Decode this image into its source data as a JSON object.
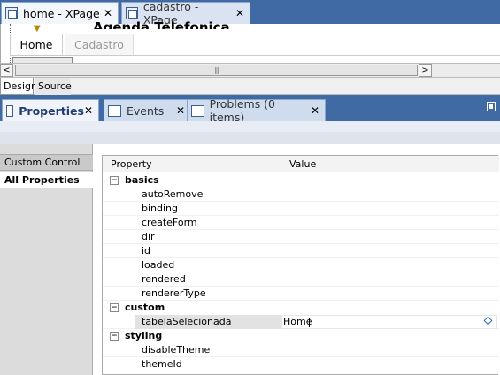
{
  "editor_tabs": [
    {
      "label": "home - XPage",
      "close": "✕"
    },
    {
      "label": "cadastro - XPage",
      "close": "✕"
    }
  ],
  "canvas": {
    "page_title": "Agenda Telefonica",
    "tabs": [
      "Home",
      "Cadastro"
    ],
    "scroll_left": "<",
    "scroll_right": ">",
    "scroll_grip": "|||"
  },
  "modes": {
    "design": "Design",
    "source": "Source"
  },
  "view_tabs": {
    "properties": "Properties",
    "events": "Events",
    "problems": "Problems (0 items)",
    "close": "✕"
  },
  "left_nav": {
    "custom_control": "Custom Control",
    "all_properties": "All Properties"
  },
  "table": {
    "col_property": "Property",
    "col_value": "Value",
    "rows": [
      {
        "type": "category",
        "name": "basics",
        "toggle": "−"
      },
      {
        "type": "property",
        "name": "autoRemove",
        "value": ""
      },
      {
        "type": "property",
        "name": "binding",
        "value": ""
      },
      {
        "type": "property",
        "name": "createForm",
        "value": ""
      },
      {
        "type": "property",
        "name": "dir",
        "value": ""
      },
      {
        "type": "property",
        "name": "id",
        "value": ""
      },
      {
        "type": "property",
        "name": "loaded",
        "value": ""
      },
      {
        "type": "property",
        "name": "rendered",
        "value": ""
      },
      {
        "type": "property",
        "name": "rendererType",
        "value": ""
      },
      {
        "type": "category",
        "name": "custom",
        "toggle": "−"
      },
      {
        "type": "property",
        "name": "tabelaSelecionada",
        "value": "Home",
        "selected": true
      },
      {
        "type": "category",
        "name": "styling",
        "toggle": "−"
      },
      {
        "type": "property",
        "name": "disableTheme",
        "value": ""
      },
      {
        "type": "property",
        "name": "themeId",
        "value": ""
      }
    ]
  },
  "colors": {
    "accent": "#3f6aa4",
    "active_tab": "#f0f4fa"
  }
}
